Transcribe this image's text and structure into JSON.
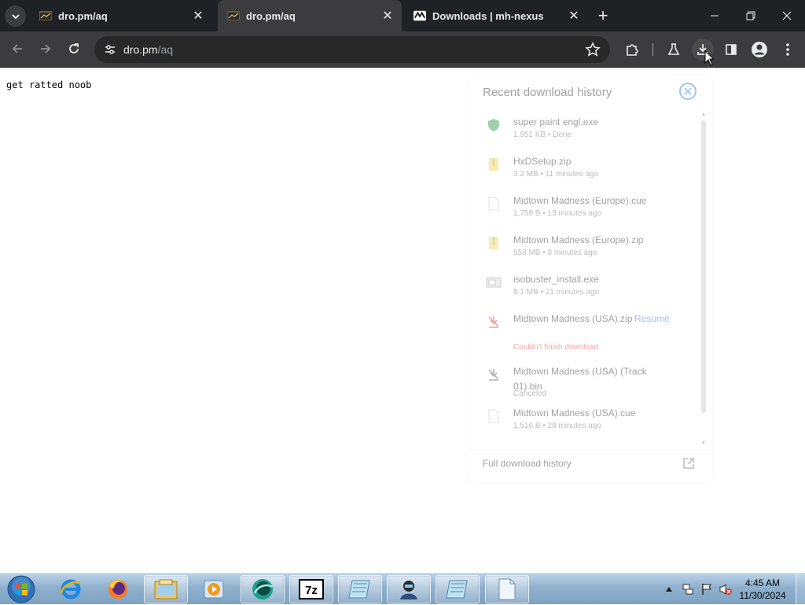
{
  "tabs": [
    {
      "title": "dro.pm/aq",
      "active": false
    },
    {
      "title": "dro.pm/aq",
      "active": true
    },
    {
      "title": "Downloads | mh-nexus",
      "active": false
    }
  ],
  "toolbar": {
    "url_host": "dro.pm",
    "url_path": "/aq"
  },
  "page": {
    "text": "get ratted noob"
  },
  "downloads": {
    "header": "Recent download history",
    "footer": "Full download history",
    "items": [
      {
        "name": "super paint engl.exe",
        "status": "1,951 KB • Done",
        "icon": "shield-icon"
      },
      {
        "name": "HxDSetup.zip",
        "status": "3.2 MB • 11 minutes ago",
        "icon": "zip-folder-icon"
      },
      {
        "name": "Midtown Madness (Europe).cue",
        "status": "1,759 B • 13 minutes ago",
        "icon": "file-icon"
      },
      {
        "name": "Midtown Madness (Europe).zip",
        "status": "558 MB • 8 minutes ago",
        "icon": "zip-folder-icon"
      },
      {
        "name": "isobuster_install.exe",
        "status": "8.1 MB • 21 minutes ago",
        "icon": "installer-icon"
      },
      {
        "name": "Midtown Madness (USA).zip",
        "status": "Couldn't finish download",
        "action": "Resume",
        "icon": "failed-download-icon"
      },
      {
        "name": "Midtown Madness (USA) (Track 01).bin",
        "status": "Canceled",
        "icon": "canceled-download-icon"
      },
      {
        "name": "Midtown Madness (USA).cue",
        "status": "1,516 B • 28 minutes ago",
        "icon": "file-icon"
      }
    ]
  },
  "taskbar": {
    "time": "4:45 AM",
    "date": "11/30/2024"
  }
}
